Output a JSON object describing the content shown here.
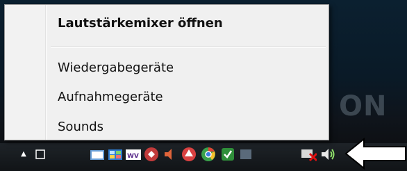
{
  "menu": {
    "items": [
      {
        "label": "Lautstärkemixer öffnen",
        "bold": true
      },
      {
        "label": "Wiedergabegeräte",
        "bold": false
      },
      {
        "label": "Aufnahmegeräte",
        "bold": false
      },
      {
        "label": "Sounds",
        "bold": false
      }
    ]
  },
  "desktop": {
    "brand_fragment": "ON"
  },
  "tray": {
    "icons": [
      "show-hidden-icon",
      "app-icon",
      "network-icon",
      "wmv-icon",
      "shield-red-icon",
      "audio-icon",
      "antivirus-icon",
      "chrome-icon",
      "check-shield-icon",
      "network-error-icon",
      "speaker-icon"
    ]
  },
  "colors": {
    "menu_bg": "#f0f0f0",
    "taskbar_bg": "#15191d",
    "arrow_fill": "#ffffff"
  }
}
